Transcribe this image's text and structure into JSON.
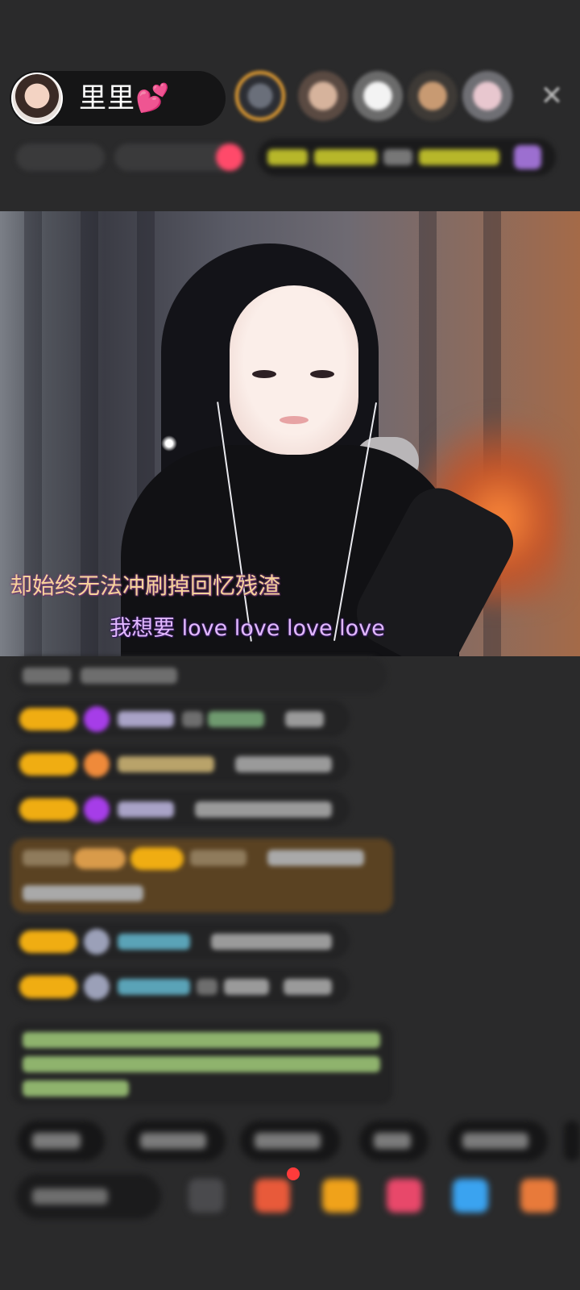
{
  "host": {
    "name": "里里💕"
  },
  "video": {
    "lyric_line1": "却始终无法冲刷掉回忆残渣",
    "lyric_line2": "我想要 love love love love"
  },
  "icons": {
    "close": "close-icon",
    "gift": "gift-icon",
    "emoji": "emoji-icon"
  },
  "colors": {
    "badge": "#f0ad12",
    "lyric1": "#f6d39b",
    "lyric2": "#e2b8ff",
    "gift_message_bg": "#5a4222"
  }
}
